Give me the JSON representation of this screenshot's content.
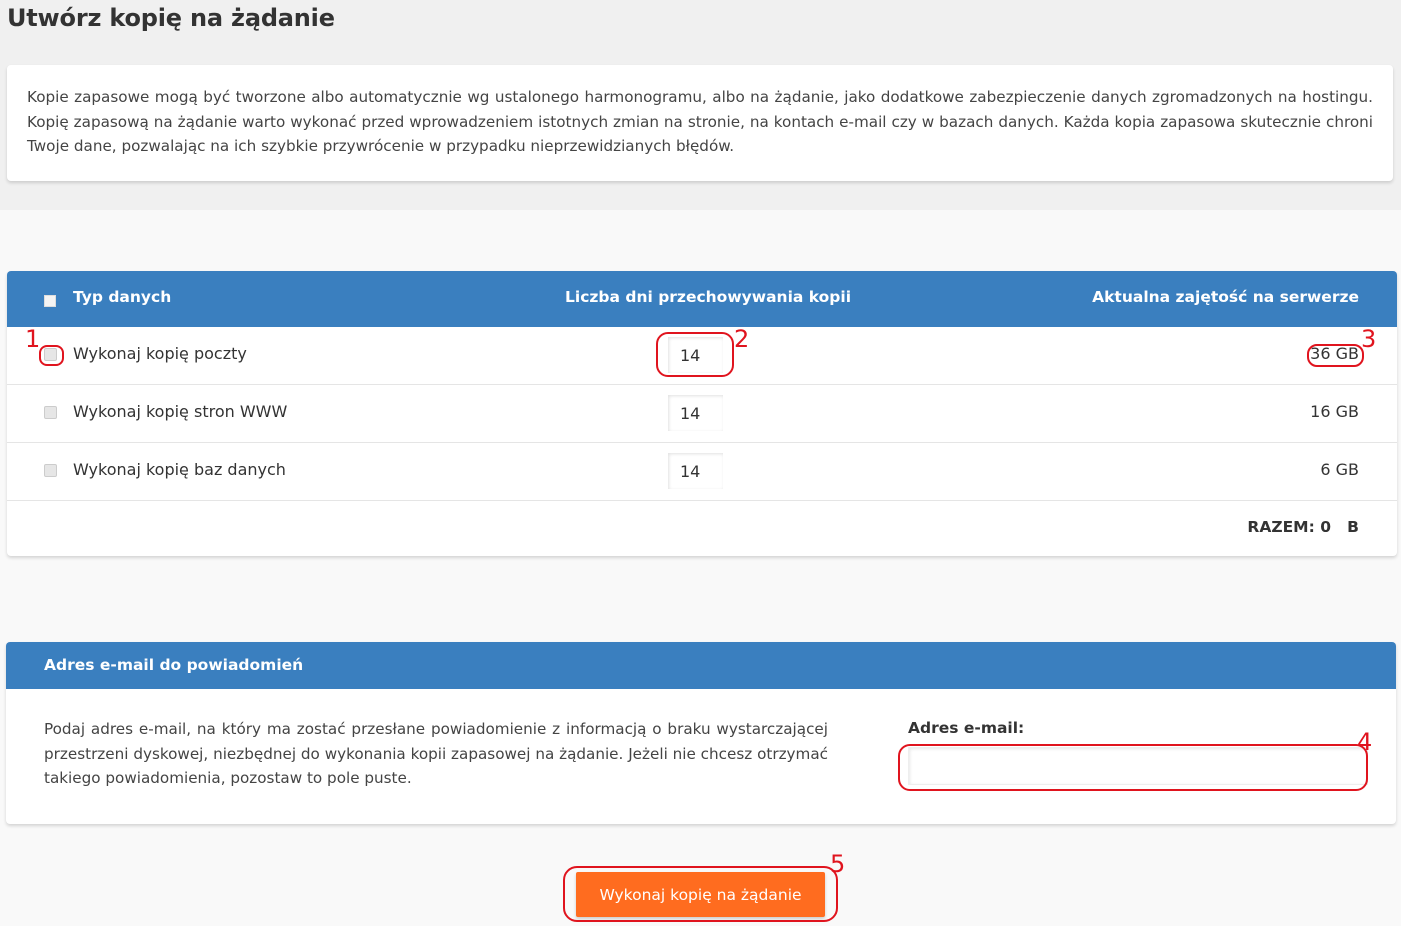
{
  "page_title": "Utwórz kopię na żądanie",
  "intro_text": "Kopie zapasowe mogą być tworzone albo automatycznie wg ustalonego harmonogramu, albo na żądanie, jako dodatkowe zabezpieczenie danych zgromadzonych na hostingu. Kopię zapasową na żądanie warto wykonać przed wprowadzeniem istotnych zmian na stronie, na kontach e-mail czy w bazach danych. Każda kopia zapasowa skutecznie chroni Twoje dane, pozwalając na ich szybkie przywrócenie w przypadku nieprzewidzianych błędów.",
  "table": {
    "headers": {
      "type": "Typ danych",
      "days": "Liczba dni przechowywania kopii",
      "usage": "Aktualna zajętość na serwerze"
    },
    "rows": [
      {
        "label": "Wykonaj kopię poczty",
        "days": "14",
        "usage": "36 GB"
      },
      {
        "label": "Wykonaj kopię stron WWW",
        "days": "14",
        "usage": "16 GB"
      },
      {
        "label": "Wykonaj kopię baz danych",
        "days": "14",
        "usage": "6 GB"
      }
    ],
    "total": "RAZEM: 0   B"
  },
  "email_section": {
    "title": "Adres e-mail do powiadomień",
    "description": "Podaj adres e-mail, na który ma zostać przesłane powiadomienie z informacją o braku wystarczającej przestrzeni dyskowej, niezbędnej do wykonania kopii zapasowej na żądanie. Jeżeli nie chcesz otrzymać takiego powiadomienia, pozostaw to pole puste.",
    "field_label": "Adres e-mail:",
    "field_value": ""
  },
  "submit_label": "Wykonaj kopię na żądanie",
  "annotations": [
    "1",
    "2",
    "3",
    "4",
    "5"
  ],
  "colors": {
    "header_blue": "#3a7fbf",
    "button_orange": "#ff6c1f",
    "annotation_red": "#e0141e"
  }
}
